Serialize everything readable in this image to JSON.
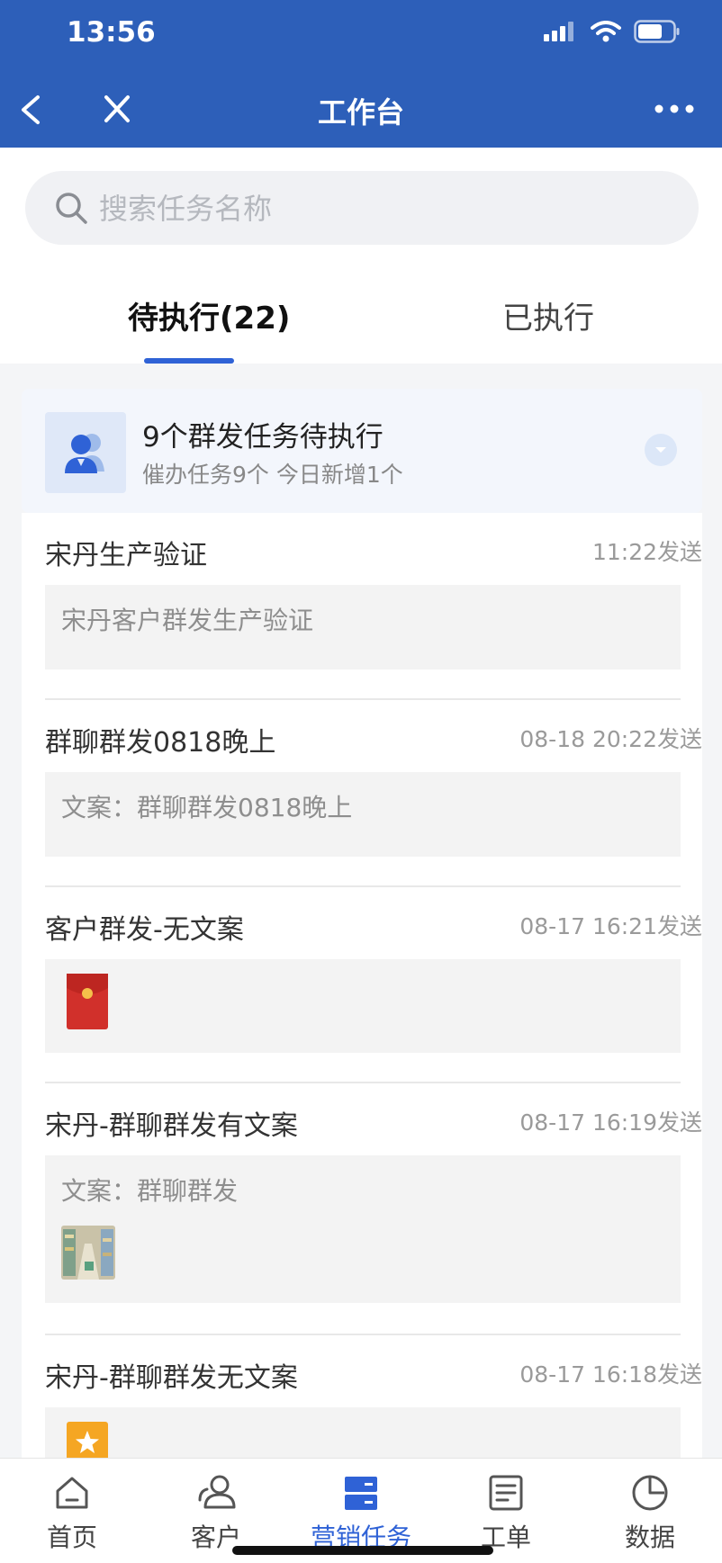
{
  "status_bar": {
    "time": "13:56"
  },
  "nav": {
    "title": "工作台"
  },
  "search": {
    "placeholder": "搜索任务名称"
  },
  "tabs": [
    {
      "label": "待执行(22)",
      "active": true
    },
    {
      "label": "已执行",
      "active": false
    }
  ],
  "summary": {
    "title": "9个群发任务待执行",
    "subtitle": "催办任务9个 今日新增1个"
  },
  "tasks": [
    {
      "title": "宋丹生产验证",
      "time": "11:22发送",
      "content": "宋丹客户群发生产验证"
    },
    {
      "title": "群聊群发0818晚上",
      "time": "08-18 20:22发送",
      "content": "文案：群聊群发0818晚上"
    },
    {
      "title": "客户群发-无文案",
      "time": "08-17 16:21发送",
      "content": "",
      "attachment": "red-envelope-icon"
    },
    {
      "title": "宋丹-群聊群发有文案",
      "time": "08-17 16:19发送",
      "content": "文案：群聊群发",
      "attachment": "image-thumbnail"
    },
    {
      "title": "宋丹-群聊群发无文案",
      "time": "08-17 16:18发送",
      "content": "",
      "attachment": "star-icon"
    }
  ],
  "tabbar": [
    {
      "label": "首页",
      "icon": "home-icon",
      "active": false
    },
    {
      "label": "客户",
      "icon": "customer-icon",
      "active": false
    },
    {
      "label": "营销任务",
      "icon": "marketing-task-icon",
      "active": true
    },
    {
      "label": "工单",
      "icon": "work-order-icon",
      "active": false
    },
    {
      "label": "数据",
      "icon": "data-chart-icon",
      "active": false
    }
  ],
  "colors": {
    "header": "#2d5fb9",
    "accent": "#2f62d6",
    "background": "#f4f5f7"
  }
}
